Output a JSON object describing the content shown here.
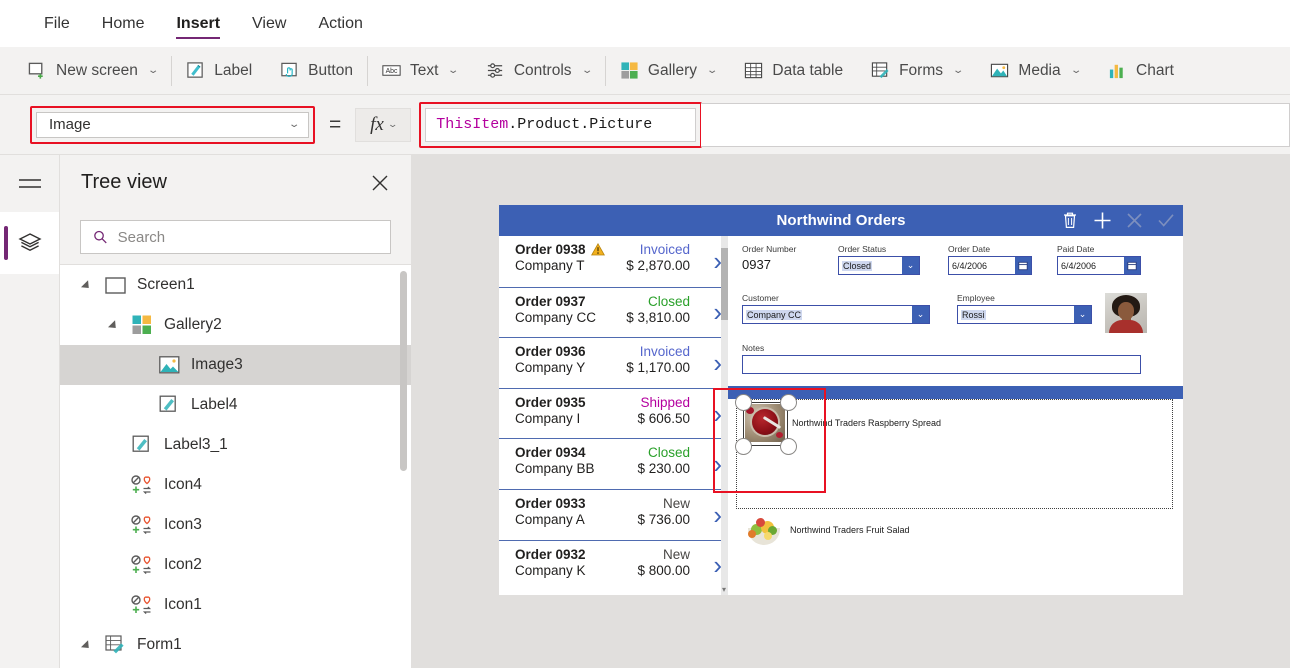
{
  "menubar": {
    "items": [
      {
        "label": "File",
        "active": false
      },
      {
        "label": "Home",
        "active": false
      },
      {
        "label": "Insert",
        "active": true
      },
      {
        "label": "View",
        "active": false
      },
      {
        "label": "Action",
        "active": false
      }
    ]
  },
  "ribbon": {
    "items": [
      {
        "label": "New screen",
        "icon": "new-screen-icon",
        "caret": true
      },
      {
        "label": "Label",
        "icon": "label-icon",
        "caret": false
      },
      {
        "label": "Button",
        "icon": "button-icon",
        "caret": false
      },
      {
        "label": "Text",
        "icon": "text-abc-icon",
        "caret": true
      },
      {
        "label": "Controls",
        "icon": "controls-sliders-icon",
        "caret": true
      },
      {
        "label": "Gallery",
        "icon": "gallery-icon",
        "caret": true
      },
      {
        "label": "Data table",
        "icon": "data-table-icon",
        "caret": false
      },
      {
        "label": "Forms",
        "icon": "forms-icon",
        "caret": true
      },
      {
        "label": "Media",
        "icon": "media-image-icon",
        "caret": true
      },
      {
        "label": "Chart",
        "icon": "chart-icon",
        "caret": false
      }
    ]
  },
  "formula_bar": {
    "property_selected": "Image",
    "equals": "=",
    "fx_label": "fx",
    "formula_identifier": "ThisItem",
    "formula_rest": ".Product.Picture",
    "highlight_color": "#e81123"
  },
  "tree_view": {
    "title": "Tree view",
    "search_placeholder": "Search",
    "search_value": "",
    "nodes": [
      {
        "label": "Screen1",
        "icon": "screen-icon",
        "indent": 0,
        "expander": true,
        "selected": false
      },
      {
        "label": "Gallery2",
        "icon": "gallery-icon",
        "indent": 1,
        "expander": true,
        "selected": false
      },
      {
        "label": "Image3",
        "icon": "image-icon",
        "indent": 2,
        "expander": false,
        "selected": true
      },
      {
        "label": "Label4",
        "icon": "label-icon",
        "indent": 2,
        "expander": false,
        "selected": false
      },
      {
        "label": "Label3_1",
        "icon": "label-icon",
        "indent": 1,
        "expander": false,
        "selected": false
      },
      {
        "label": "Icon4",
        "icon": "icon-set-icon",
        "indent": 1,
        "expander": false,
        "selected": false
      },
      {
        "label": "Icon3",
        "icon": "icon-set-icon",
        "indent": 1,
        "expander": false,
        "selected": false
      },
      {
        "label": "Icon2",
        "icon": "icon-set-icon",
        "indent": 1,
        "expander": false,
        "selected": false
      },
      {
        "label": "Icon1",
        "icon": "icon-set-icon",
        "indent": 1,
        "expander": false,
        "selected": false
      },
      {
        "label": "Form1",
        "icon": "form-icon",
        "indent": 0,
        "expander": true,
        "selected": false
      }
    ]
  },
  "app_canvas": {
    "title": "Northwind Orders",
    "title_bar_color": "#3c60b4",
    "title_icons": [
      {
        "name": "delete-icon",
        "enabled": true
      },
      {
        "name": "add-icon",
        "enabled": true
      },
      {
        "name": "cancel-icon",
        "enabled": false
      },
      {
        "name": "save-icon",
        "enabled": false
      }
    ],
    "orders": [
      {
        "order": "Order 0938",
        "company": "Company T",
        "status": "Invoiced",
        "amount": "$ 2,870.00",
        "warning": true
      },
      {
        "order": "Order 0937",
        "company": "Company CC",
        "status": "Closed",
        "amount": "$ 3,810.00",
        "warning": false
      },
      {
        "order": "Order 0936",
        "company": "Company Y",
        "status": "Invoiced",
        "amount": "$ 1,170.00",
        "warning": false
      },
      {
        "order": "Order 0935",
        "company": "Company I",
        "status": "Shipped",
        "amount": "$ 606.50",
        "warning": false
      },
      {
        "order": "Order 0934",
        "company": "Company BB",
        "status": "Closed",
        "amount": "$ 230.00",
        "warning": false
      },
      {
        "order": "Order 0933",
        "company": "Company A",
        "status": "New",
        "amount": "$ 736.00",
        "warning": false
      },
      {
        "order": "Order 0932",
        "company": "Company K",
        "status": "New",
        "amount": "$ 800.00",
        "warning": false
      }
    ],
    "detail_form": {
      "order_number": {
        "label": "Order Number",
        "value": "0937"
      },
      "order_status": {
        "label": "Order Status",
        "value": "Closed"
      },
      "order_date": {
        "label": "Order Date",
        "value": "6/4/2006"
      },
      "paid_date": {
        "label": "Paid Date",
        "value": "6/4/2006"
      },
      "customer": {
        "label": "Customer",
        "value": "Company CC"
      },
      "employee": {
        "label": "Employee",
        "value": "Rossi"
      },
      "notes": {
        "label": "Notes",
        "value": ""
      }
    },
    "detail_gallery": {
      "rows": [
        {
          "product": "Northwind Traders Raspberry Spread",
          "image": "raspberry-spread-image",
          "selected": true
        },
        {
          "product": "Northwind Traders Fruit Salad",
          "image": "fruit-salad-image",
          "selected": false
        }
      ]
    }
  }
}
